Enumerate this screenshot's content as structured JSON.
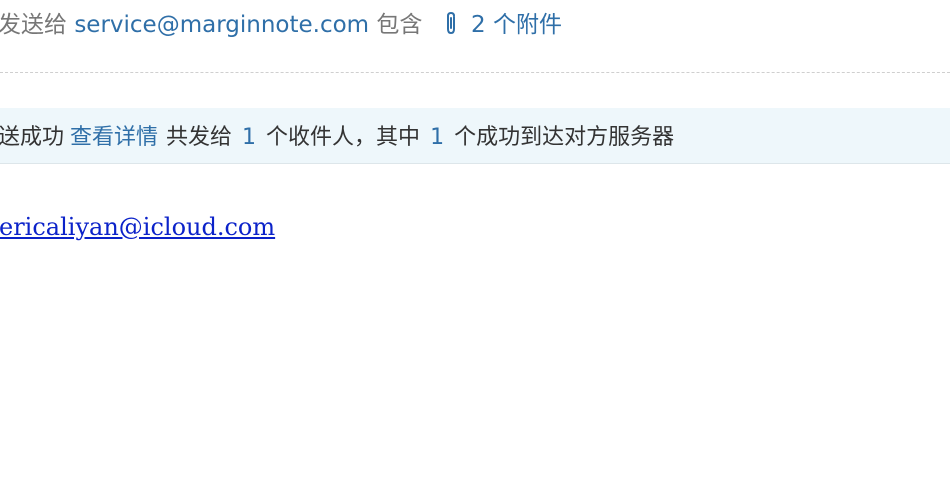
{
  "header": {
    "sent_to_label": "发送给",
    "recipient": "service@marginnote.com",
    "includes_label": "包含",
    "attachment_count": "2",
    "attachment_unit": "个附件",
    "attachment_icon": "paperclip-icon"
  },
  "status": {
    "success_text": "送成功",
    "details_link": "查看详情",
    "sent_to_text": "共发给",
    "recipient_count": "1",
    "recipients_suffix": "个收件人，其中",
    "delivered_count": "1",
    "delivered_suffix": "个成功到达对方服务器"
  },
  "body": {
    "email": "ericaliyan@icloud.com"
  },
  "colors": {
    "link": "#2f6fa8",
    "status_background": "#eef7fb",
    "email_link": "#0b22c9"
  }
}
